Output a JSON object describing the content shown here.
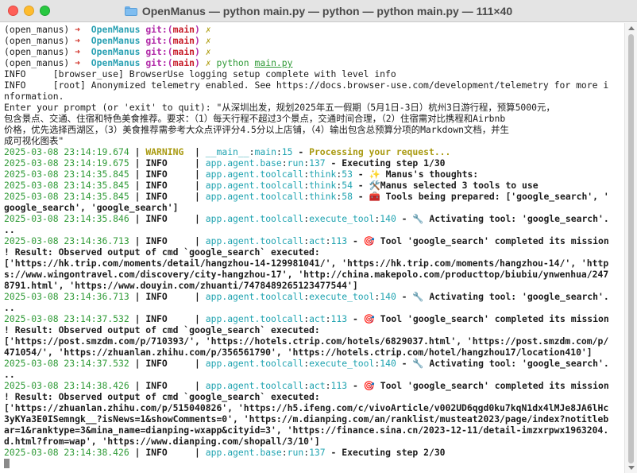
{
  "window": {
    "title": "OpenManus — python main.py — python — python main.py — 111×40",
    "folder_icon": "folder-icon"
  },
  "colors": {
    "prompt_arrow": "#d1332a",
    "env_name": "#2aa1b3",
    "git_label": "#b12aa8",
    "branch": "#c71d2a",
    "timestamp": "#2f9a36",
    "module": "#1fa3b0",
    "warning": "#a99a11"
  },
  "prompt": {
    "env": "(open_manus)",
    "arrow": "➜",
    "dir": "OpenManus",
    "git_prefix": "git:(",
    "branch": "main",
    "git_suffix": ")",
    "dirty": "✗",
    "command": "python",
    "command_arg": "main.py"
  },
  "info_lines": [
    "INFO     [browser_use] BrowserUse logging setup complete with level info",
    "INFO     [root] Anonymized telemetry enabled. See https://docs.browser-use.com/development/telemetry for more i",
    "nformation."
  ],
  "user_prompt_lines": [
    "Enter your prompt (or 'exit' to quit): \"从深圳出发，规划2025年五一假期（5月1日-3日）杭州3日游行程，预算5000元，",
    "包含景点、交通、住宿和特色美食推荐。要求：（1）每天行程不超过3个景点，交通时间合理，（2）住宿需对比携程和Airbnb",
    "价格，优先选择西湖区，（3）美食推荐需参考大众点评评分4.5分以上店铺，（4）输出包含总预算分项的Markdown文档，并生",
    "成可视化图表\""
  ],
  "log": [
    {
      "ts": "2025-03-08 23:14:19.674",
      "level": "WARNING",
      "mod": "__main__",
      "fn": "main",
      "ln": "15",
      "msg": "Processing your request..."
    },
    {
      "ts": "2025-03-08 23:14:19.675",
      "level": "INFO",
      "mod": "app.agent.base",
      "fn": "run",
      "ln": "137",
      "msg": "Executing step 1/30"
    },
    {
      "ts": "2025-03-08 23:14:35.845",
      "level": "INFO",
      "mod": "app.agent.toolcall",
      "fn": "think",
      "ln": "53",
      "msg": "✨ Manus's thoughts:"
    },
    {
      "ts": "2025-03-08 23:14:35.845",
      "level": "INFO",
      "mod": "app.agent.toolcall",
      "fn": "think",
      "ln": "54",
      "msg": "🛠️Manus selected 3 tools to use"
    },
    {
      "ts": "2025-03-08 23:14:35.845",
      "level": "INFO",
      "mod": "app.agent.toolcall",
      "fn": "think",
      "ln": "58",
      "msg": "🧰 Tools being prepared: ['google_search', '",
      "cont": [
        "google_search', 'google_search']"
      ]
    },
    {
      "ts": "2025-03-08 23:14:35.846",
      "level": "INFO",
      "mod": "app.agent.toolcall",
      "fn": "execute_tool",
      "ln": "140",
      "msg": "🔧 Activating tool: 'google_search'.",
      "cont": [
        ".."
      ]
    },
    {
      "ts": "2025-03-08 23:14:36.713",
      "level": "INFO",
      "mod": "app.agent.toolcall",
      "fn": "act",
      "ln": "113",
      "msg": "🎯 Tool 'google_search' completed its mission",
      "cont": [
        "! Result: Observed output of cmd `google_search` executed:",
        "['https://hk.trip.com/moments/detail/hangzhou-14-129981041/', 'https://hk.trip.com/moments/hangzhou-14/', 'http",
        "s://www.wingontravel.com/discovery/city-hangzhou-17', 'http://china.makepolo.com/producttop/biubiu/ynwenhua/247",
        "8791.html', 'https://www.douyin.com/zhuanti/7478489265123477544']"
      ]
    },
    {
      "ts": "2025-03-08 23:14:36.713",
      "level": "INFO",
      "mod": "app.agent.toolcall",
      "fn": "execute_tool",
      "ln": "140",
      "msg": "🔧 Activating tool: 'google_search'.",
      "cont": [
        ".."
      ]
    },
    {
      "ts": "2025-03-08 23:14:37.532",
      "level": "INFO",
      "mod": "app.agent.toolcall",
      "fn": "act",
      "ln": "113",
      "msg": "🎯 Tool 'google_search' completed its mission",
      "cont": [
        "! Result: Observed output of cmd `google_search` executed:",
        "['https://post.smzdm.com/p/710393/', 'https://hotels.ctrip.com/hotels/6829037.html', 'https://post.smzdm.com/p/",
        "471054/', 'https://zhuanlan.zhihu.com/p/356561790', 'https://hotels.ctrip.com/hotel/hangzhou17/location410']"
      ]
    },
    {
      "ts": "2025-03-08 23:14:37.532",
      "level": "INFO",
      "mod": "app.agent.toolcall",
      "fn": "execute_tool",
      "ln": "140",
      "msg": "🔧 Activating tool: 'google_search'.",
      "cont": [
        ".."
      ]
    },
    {
      "ts": "2025-03-08 23:14:38.426",
      "level": "INFO",
      "mod": "app.agent.toolcall",
      "fn": "act",
      "ln": "113",
      "msg": "🎯 Tool 'google_search' completed its mission",
      "cont": [
        "! Result: Observed output of cmd `google_search` executed:",
        "['https://zhuanlan.zhihu.com/p/515040826', 'https://h5.ifeng.com/c/vivoArticle/v002UD6qgd0ku7kqN1dx4lMJe8JA6lHc",
        "3yKYa3E0ISemngk__?isNews=1&showComments=0', 'https://m.dianping.com/an/ranklist/musteat2023/page/index?notitleb",
        "ar=1&ranktype=3&mina_name=dianping-wxapp&cityid=3', 'https://finance.sina.cn/2023-12-11/detail-imzxrpwx1963204.",
        "d.html?from=wap', 'https://www.dianping.com/shopall/3/10']"
      ]
    },
    {
      "ts": "2025-03-08 23:14:38.426",
      "level": "INFO",
      "mod": "app.agent.base",
      "fn": "run",
      "ln": "137",
      "msg": "Executing step 2/30"
    }
  ]
}
